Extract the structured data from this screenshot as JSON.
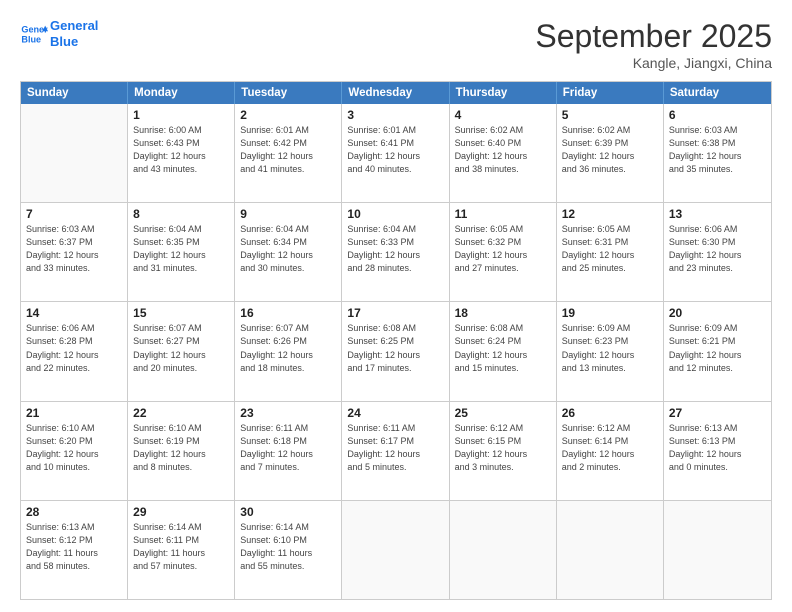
{
  "logo": {
    "line1": "General",
    "line2": "Blue"
  },
  "title": "September 2025",
  "subtitle": "Kangle, Jiangxi, China",
  "header_days": [
    "Sunday",
    "Monday",
    "Tuesday",
    "Wednesday",
    "Thursday",
    "Friday",
    "Saturday"
  ],
  "rows": [
    [
      {
        "day": "",
        "info": ""
      },
      {
        "day": "1",
        "info": "Sunrise: 6:00 AM\nSunset: 6:43 PM\nDaylight: 12 hours\nand 43 minutes."
      },
      {
        "day": "2",
        "info": "Sunrise: 6:01 AM\nSunset: 6:42 PM\nDaylight: 12 hours\nand 41 minutes."
      },
      {
        "day": "3",
        "info": "Sunrise: 6:01 AM\nSunset: 6:41 PM\nDaylight: 12 hours\nand 40 minutes."
      },
      {
        "day": "4",
        "info": "Sunrise: 6:02 AM\nSunset: 6:40 PM\nDaylight: 12 hours\nand 38 minutes."
      },
      {
        "day": "5",
        "info": "Sunrise: 6:02 AM\nSunset: 6:39 PM\nDaylight: 12 hours\nand 36 minutes."
      },
      {
        "day": "6",
        "info": "Sunrise: 6:03 AM\nSunset: 6:38 PM\nDaylight: 12 hours\nand 35 minutes."
      }
    ],
    [
      {
        "day": "7",
        "info": "Sunrise: 6:03 AM\nSunset: 6:37 PM\nDaylight: 12 hours\nand 33 minutes."
      },
      {
        "day": "8",
        "info": "Sunrise: 6:04 AM\nSunset: 6:35 PM\nDaylight: 12 hours\nand 31 minutes."
      },
      {
        "day": "9",
        "info": "Sunrise: 6:04 AM\nSunset: 6:34 PM\nDaylight: 12 hours\nand 30 minutes."
      },
      {
        "day": "10",
        "info": "Sunrise: 6:04 AM\nSunset: 6:33 PM\nDaylight: 12 hours\nand 28 minutes."
      },
      {
        "day": "11",
        "info": "Sunrise: 6:05 AM\nSunset: 6:32 PM\nDaylight: 12 hours\nand 27 minutes."
      },
      {
        "day": "12",
        "info": "Sunrise: 6:05 AM\nSunset: 6:31 PM\nDaylight: 12 hours\nand 25 minutes."
      },
      {
        "day": "13",
        "info": "Sunrise: 6:06 AM\nSunset: 6:30 PM\nDaylight: 12 hours\nand 23 minutes."
      }
    ],
    [
      {
        "day": "14",
        "info": "Sunrise: 6:06 AM\nSunset: 6:28 PM\nDaylight: 12 hours\nand 22 minutes."
      },
      {
        "day": "15",
        "info": "Sunrise: 6:07 AM\nSunset: 6:27 PM\nDaylight: 12 hours\nand 20 minutes."
      },
      {
        "day": "16",
        "info": "Sunrise: 6:07 AM\nSunset: 6:26 PM\nDaylight: 12 hours\nand 18 minutes."
      },
      {
        "day": "17",
        "info": "Sunrise: 6:08 AM\nSunset: 6:25 PM\nDaylight: 12 hours\nand 17 minutes."
      },
      {
        "day": "18",
        "info": "Sunrise: 6:08 AM\nSunset: 6:24 PM\nDaylight: 12 hours\nand 15 minutes."
      },
      {
        "day": "19",
        "info": "Sunrise: 6:09 AM\nSunset: 6:23 PM\nDaylight: 12 hours\nand 13 minutes."
      },
      {
        "day": "20",
        "info": "Sunrise: 6:09 AM\nSunset: 6:21 PM\nDaylight: 12 hours\nand 12 minutes."
      }
    ],
    [
      {
        "day": "21",
        "info": "Sunrise: 6:10 AM\nSunset: 6:20 PM\nDaylight: 12 hours\nand 10 minutes."
      },
      {
        "day": "22",
        "info": "Sunrise: 6:10 AM\nSunset: 6:19 PM\nDaylight: 12 hours\nand 8 minutes."
      },
      {
        "day": "23",
        "info": "Sunrise: 6:11 AM\nSunset: 6:18 PM\nDaylight: 12 hours\nand 7 minutes."
      },
      {
        "day": "24",
        "info": "Sunrise: 6:11 AM\nSunset: 6:17 PM\nDaylight: 12 hours\nand 5 minutes."
      },
      {
        "day": "25",
        "info": "Sunrise: 6:12 AM\nSunset: 6:15 PM\nDaylight: 12 hours\nand 3 minutes."
      },
      {
        "day": "26",
        "info": "Sunrise: 6:12 AM\nSunset: 6:14 PM\nDaylight: 12 hours\nand 2 minutes."
      },
      {
        "day": "27",
        "info": "Sunrise: 6:13 AM\nSunset: 6:13 PM\nDaylight: 12 hours\nand 0 minutes."
      }
    ],
    [
      {
        "day": "28",
        "info": "Sunrise: 6:13 AM\nSunset: 6:12 PM\nDaylight: 11 hours\nand 58 minutes."
      },
      {
        "day": "29",
        "info": "Sunrise: 6:14 AM\nSunset: 6:11 PM\nDaylight: 11 hours\nand 57 minutes."
      },
      {
        "day": "30",
        "info": "Sunrise: 6:14 AM\nSunset: 6:10 PM\nDaylight: 11 hours\nand 55 minutes."
      },
      {
        "day": "",
        "info": ""
      },
      {
        "day": "",
        "info": ""
      },
      {
        "day": "",
        "info": ""
      },
      {
        "day": "",
        "info": ""
      }
    ]
  ]
}
